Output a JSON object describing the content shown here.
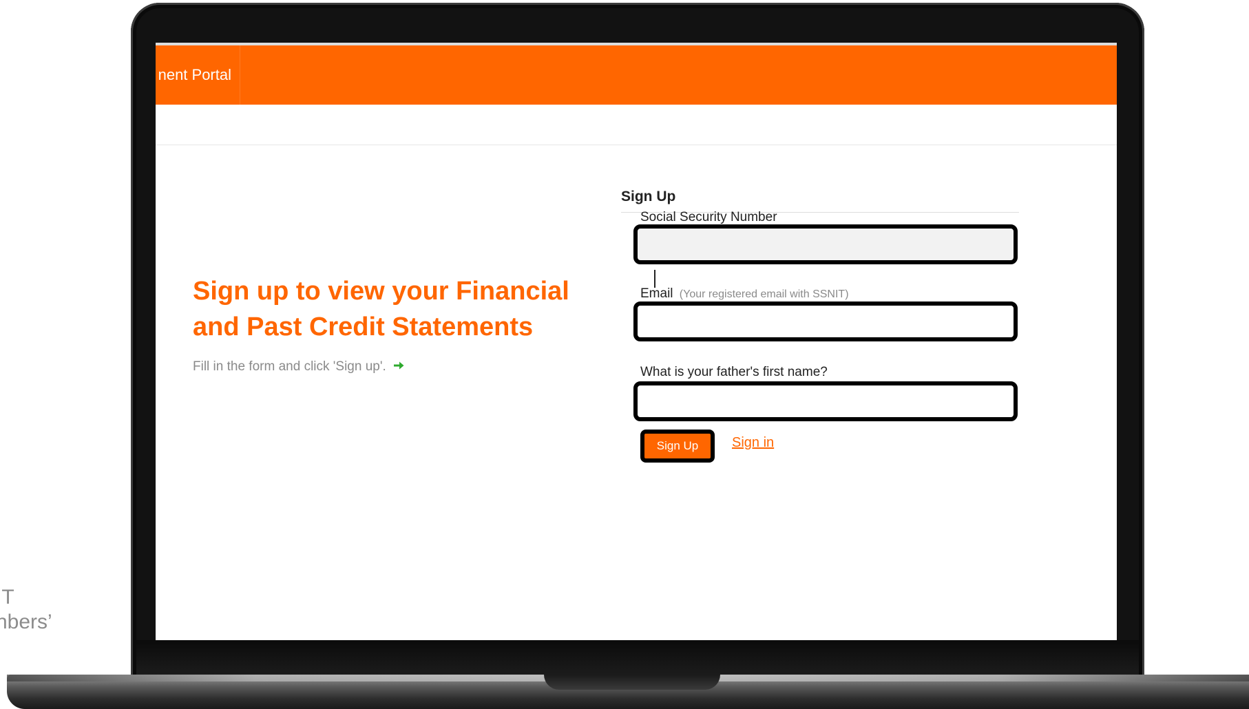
{
  "background_text": {
    "line1": "IT",
    "line2": "nbers’"
  },
  "header": {
    "title": "nent Portal",
    "brand_color": "#ff6600"
  },
  "promo": {
    "heading": "Sign up to view your Financial and Past Credit Statements",
    "subtext": "Fill in the form and click 'Sign up'.",
    "arrow_icon": "arrow-right-icon",
    "arrow_color": "#2eaa2e"
  },
  "form": {
    "title": "Sign Up",
    "fields": {
      "ssn": {
        "label": "Social Security Number",
        "value": "",
        "focused": true
      },
      "email": {
        "label": "Email",
        "hint": "(Your registered email with SSNIT)",
        "value": ""
      },
      "father_name": {
        "label": "What is your father's first name?",
        "value": ""
      }
    },
    "submit_label": "Sign Up",
    "signin_label": "Sign in"
  }
}
